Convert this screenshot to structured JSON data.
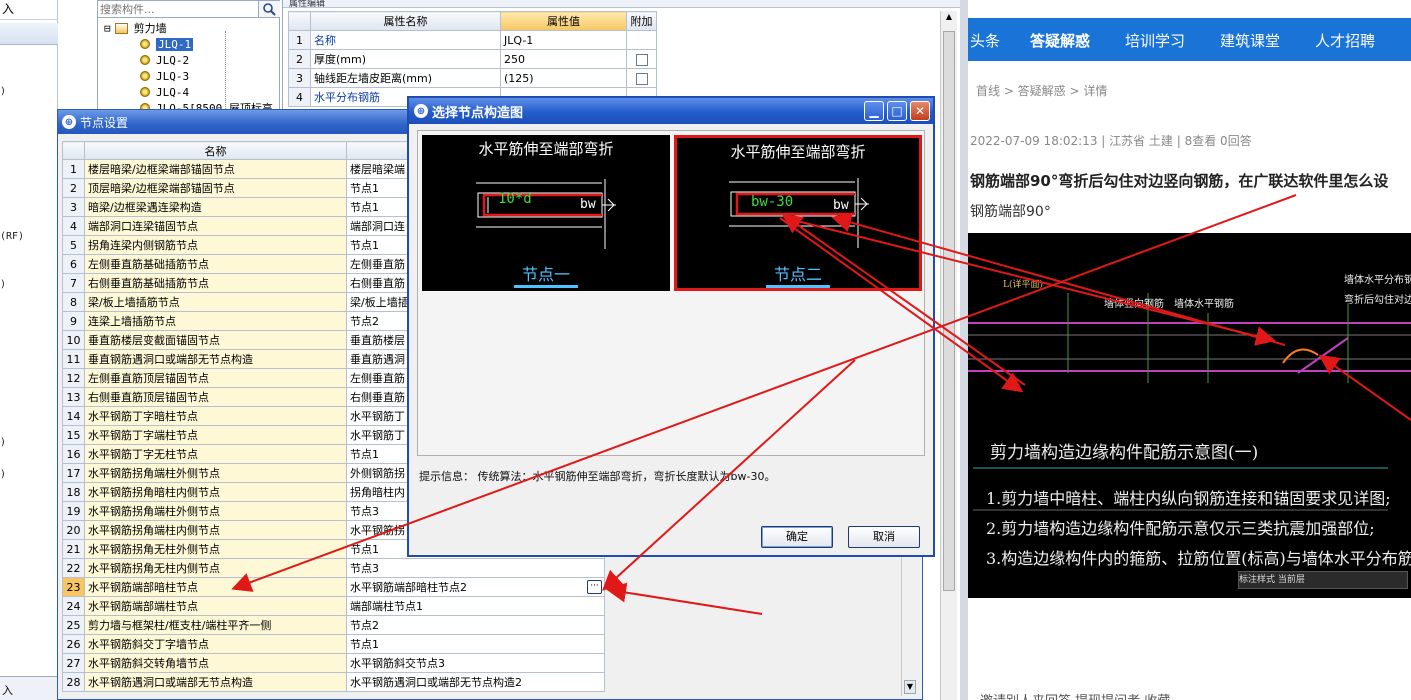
{
  "left_strip": {
    "top_fragment": "入",
    "fragments": [
      ")",
      "(RF)",
      ")",
      ")",
      ")"
    ],
    "bottom_fragment": "入"
  },
  "tree": {
    "search_placeholder": "搜索构件...",
    "root_label": "剪力墙",
    "expander": "⊟",
    "items": [
      "JLQ-1",
      "JLQ-2",
      "JLQ-3",
      "JLQ-4",
      "JLQ-5[8500 屋顶标高"
    ],
    "selected_index": 0
  },
  "property_grid": {
    "tab_label": "属性编辑",
    "headers": [
      "属性名称",
      "属性值",
      "附加"
    ],
    "rows": [
      {
        "num": "1",
        "name": "名称",
        "value": "JLQ-1",
        "has_check": false
      },
      {
        "num": "2",
        "name": "厚度(mm)",
        "value": "250",
        "has_check": true
      },
      {
        "num": "3",
        "name": "轴线距左墙皮距离(mm)",
        "value": "(125)",
        "has_check": true
      },
      {
        "num": "4",
        "name": "水平分布钢筋",
        "value": "",
        "has_check": false
      }
    ]
  },
  "node_dialog": {
    "title": "节点设置",
    "header_name": "名称",
    "header_value": "",
    "ellipsis": "···",
    "rows": [
      {
        "num": "1",
        "name": "楼层暗梁/边框梁端部锚固节点",
        "value": "楼层暗梁端"
      },
      {
        "num": "2",
        "name": "顶层暗梁/边框梁端部锚固节点",
        "value": "节点1"
      },
      {
        "num": "3",
        "name": "暗梁/边框梁遇连梁构造",
        "value": "节点1"
      },
      {
        "num": "4",
        "name": "端部洞口连梁锚固节点",
        "value": "端部洞口连"
      },
      {
        "num": "5",
        "name": "拐角连梁内侧钢筋节点",
        "value": "节点1"
      },
      {
        "num": "6",
        "name": "左侧垂直筋基础插筋节点",
        "value": "左侧垂直筋"
      },
      {
        "num": "7",
        "name": "右侧垂直筋基础插筋节点",
        "value": "右侧垂直筋"
      },
      {
        "num": "8",
        "name": "梁/板上墙插筋节点",
        "value": "梁/板上墙插"
      },
      {
        "num": "9",
        "name": "连梁上墙插筋节点",
        "value": "节点2"
      },
      {
        "num": "10",
        "name": "垂直筋楼层变截面锚固节点",
        "value": "垂直筋楼层"
      },
      {
        "num": "11",
        "name": "垂直钢筋遇洞口或端部无节点构造",
        "value": "垂直筋遇洞"
      },
      {
        "num": "12",
        "name": "左侧垂直筋顶层锚固节点",
        "value": "左侧垂直筋"
      },
      {
        "num": "13",
        "name": "右侧垂直筋顶层锚固节点",
        "value": "右侧垂直筋"
      },
      {
        "num": "14",
        "name": "水平钢筋丁字暗柱节点",
        "value": "水平钢筋丁"
      },
      {
        "num": "15",
        "name": "水平钢筋丁字端柱节点",
        "value": "水平钢筋丁"
      },
      {
        "num": "16",
        "name": "水平钢筋丁字无柱节点",
        "value": "节点1"
      },
      {
        "num": "17",
        "name": "水平钢筋拐角端柱外侧节点",
        "value": "外侧钢筋拐"
      },
      {
        "num": "18",
        "name": "水平钢筋拐角暗柱内侧节点",
        "value": "拐角暗柱内"
      },
      {
        "num": "19",
        "name": "水平钢筋拐角端柱外侧节点",
        "value": "节点3"
      },
      {
        "num": "20",
        "name": "水平钢筋拐角端柱内侧节点",
        "value": "水平钢筋拐"
      },
      {
        "num": "21",
        "name": "水平钢筋拐角无柱外侧节点",
        "value": "节点1"
      },
      {
        "num": "22",
        "name": "水平钢筋拐角无柱内侧节点",
        "value": "节点3"
      },
      {
        "num": "23",
        "name": "水平钢筋端部暗柱节点",
        "value": "水平钢筋端部暗柱节点2"
      },
      {
        "num": "24",
        "name": "水平钢筋端部端柱节点",
        "value": "端部端柱节点1"
      },
      {
        "num": "25",
        "name": "剪力墙与框架柱/框支柱/端柱平齐一侧",
        "value": "节点2"
      },
      {
        "num": "26",
        "name": "水平钢筋斜交丁字墙节点",
        "value": "节点1"
      },
      {
        "num": "27",
        "name": "水平钢筋斜交转角墙节点",
        "value": "水平钢筋斜交节点3"
      },
      {
        "num": "28",
        "name": "水平钢筋遇洞口或端部无节点构造",
        "value": "水平钢筋遇洞口或端部无节点构造2"
      }
    ],
    "selected_row": 23
  },
  "select_dialog": {
    "title": "选择节点构造图",
    "option1": {
      "title": "水平筋伸至端部弯折",
      "formula": "10*d",
      "bw": "bw",
      "label": "节点一"
    },
    "option2": {
      "title": "水平筋伸至端部弯折",
      "formula": "bw-30",
      "bw": "bw",
      "label": "节点二"
    },
    "selected_option": 2,
    "hint": "提示信息： 传统算法：水平钢筋伸至端部弯折，弯折长度默认为bw-30。",
    "ok_label": "确定",
    "cancel_label": "取消"
  },
  "web": {
    "nav": [
      "头条",
      "答疑解惑",
      "培训学习",
      "建筑课堂",
      "人才招聘"
    ],
    "active_nav": "答疑解惑",
    "breadcrumb": "首线 > 答疑解惑 > 详情",
    "meta": "2022-07-09 18:02:13  |  江苏省 土建  |  8查看 0回答",
    "question_title": "钢筋端部90°弯折后勾住对边竖向钢筋，在广联达软件里怎么设",
    "question_sub": "钢筋端部90°",
    "cad_title": "剪力墙构造边缘构件配筋示意图(一)",
    "cad_notes": [
      "1.剪力墙中暗柱、端柱内纵向钢筋连接和锚固要求见详图;",
      "2.剪力墙构造边缘构件配筋示意仅示三类抗震加强部位;",
      "3.构造边缘构件内的箍筋、拉筋位置(标高)与墙体水平分布筋相同。"
    ],
    "cad_labels": [
      "L(详平面)",
      "墙体竖向钢筋",
      "墙体水平钢筋",
      "墙体水平分布钢筋",
      "弯折后勾住对边竖"
    ],
    "cad_bar": "标注样式  当前层",
    "footer": "邀请别人来回答    提现提问者    收藏"
  },
  "colors": {
    "accent_blue": "#2f64c8",
    "highlight_red": "#e01818",
    "header_orange": "#f7c663",
    "web_nav": "#1a73d6"
  }
}
